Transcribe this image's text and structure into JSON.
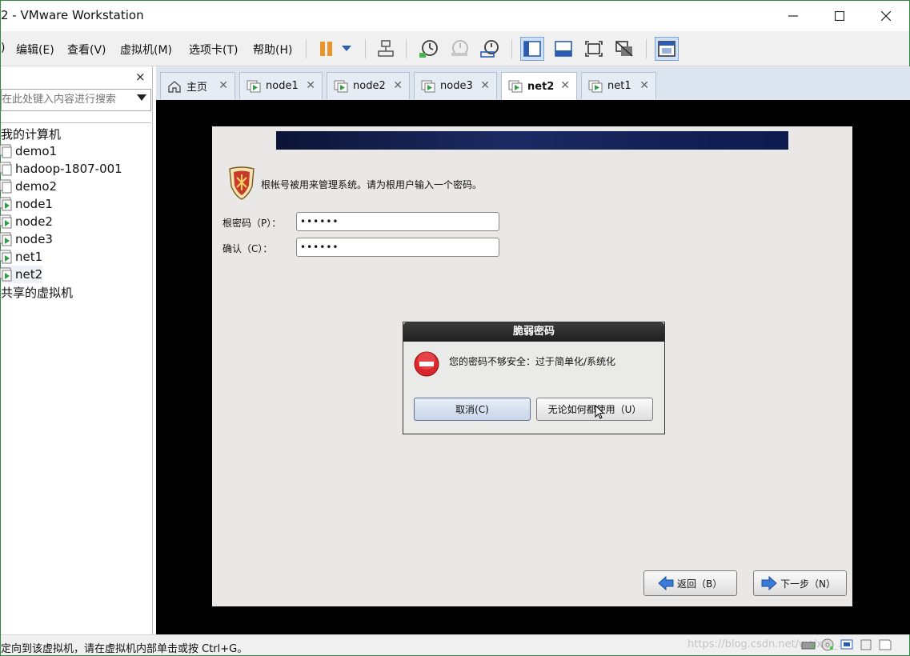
{
  "window": {
    "title": "2 - VMware Workstation",
    "minimize": "—",
    "maximize": "☐",
    "close": "✕"
  },
  "menubar": {
    "items": [
      "编辑(E)",
      "查看(V)",
      "虚拟机(M)",
      "选项卡(T)",
      "帮助(H)"
    ],
    "left_fragment": ")"
  },
  "library": {
    "close": "×",
    "search_placeholder": "在此处键入内容进行搜索",
    "tree": {
      "root": "我的计算机",
      "vms": [
        "demo1",
        "hadoop-1807-001",
        "demo2",
        "node1",
        "node2",
        "node3",
        "net1",
        "net2"
      ],
      "shared": "共享的虚拟机"
    }
  },
  "tabs": [
    {
      "label": "主页",
      "icon": "home-icon"
    },
    {
      "label": "node1",
      "icon": "vm-icon"
    },
    {
      "label": "node2",
      "icon": "vm-icon"
    },
    {
      "label": "node3",
      "icon": "vm-icon"
    },
    {
      "label": "net2",
      "icon": "vm-icon",
      "active": true
    },
    {
      "label": "net1",
      "icon": "vm-icon"
    }
  ],
  "installer": {
    "prompt": "根帐号被用来管理系统。请为根用户输入一个密码。",
    "password_label": "根密码（P）：",
    "password_value": "••••••",
    "confirm_label": "确认（C）：",
    "confirm_value": "••••••",
    "back_label": "返回（B）",
    "next_label": "下一步（N）"
  },
  "dialog": {
    "title": "脆弱密码",
    "message": "您的密码不够安全：过于简单化/系统化",
    "cancel_label": "取消(C)",
    "use_anyway_label": "无论如何都使用（U）"
  },
  "status": {
    "text": "定向到该虚拟机，请在虚拟机内部单击或按 Ctrl+G。",
    "watermark": "https://blog.csdn.net/weixin_..."
  },
  "colors": {
    "accent": "#3b7bd4",
    "titlebar_border": "#2f8c3e",
    "dialog_header": "#2b2b2b"
  }
}
